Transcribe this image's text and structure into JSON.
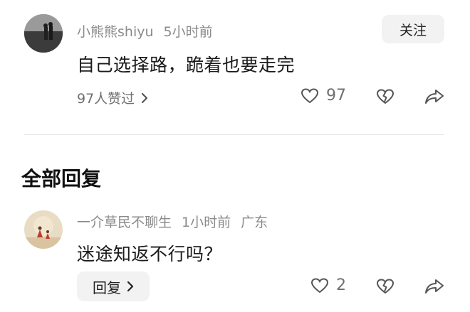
{
  "comment": {
    "author": "小熊熊shiyu",
    "time": "5小时前",
    "text": "自己选择路，跪着也要走完",
    "likes_summary": "97人赞过",
    "like_count": "97",
    "follow_label": "关注"
  },
  "section": {
    "title": "全部回复"
  },
  "reply": {
    "author": "一介草民不聊生",
    "time": "1小时前",
    "location": "广东",
    "text": "迷途知返不行吗？",
    "reply_label": "回复",
    "like_count": "2"
  },
  "icons": {
    "like": "heart-outline-icon",
    "dislike": "broken-heart-icon",
    "share": "share-arrow-icon",
    "chevron": "chevron-right-icon"
  }
}
